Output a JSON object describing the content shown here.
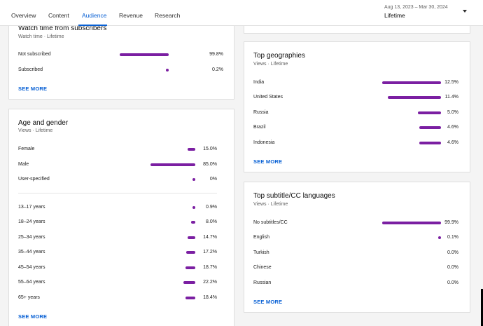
{
  "tabs": [
    "Overview",
    "Content",
    "Audience",
    "Revenue",
    "Research"
  ],
  "date_range": "Aug 13, 2023 – Mar 30, 2024",
  "date_label": "Lifetime",
  "accent_color": "#065fd4",
  "bar_color": "#7b1fa2",
  "watch_time": {
    "title": "Watch time from subscribers",
    "subtitle": "Watch time · Lifetime",
    "rows": [
      {
        "label": "Not subscribed",
        "value": "99.8%",
        "pct": 99.8
      },
      {
        "label": "Subscribed",
        "value": "0.2%",
        "pct": 0.2
      }
    ],
    "see_more": "SEE MORE"
  },
  "age_gender": {
    "title": "Age and gender",
    "subtitle": "Views · Lifetime",
    "gender_rows": [
      {
        "label": "Female",
        "value": "15.0%",
        "pct": 15.0
      },
      {
        "label": "Male",
        "value": "85.0%",
        "pct": 85.0
      },
      {
        "label": "User-specified",
        "value": "0%",
        "pct": 0
      }
    ],
    "age_rows": [
      {
        "label": "13–17 years",
        "value": "0.9%",
        "pct": 0.9
      },
      {
        "label": "18–24 years",
        "value": "8.0%",
        "pct": 8.0
      },
      {
        "label": "25–34 years",
        "value": "14.7%",
        "pct": 14.7
      },
      {
        "label": "35–44 years",
        "value": "17.2%",
        "pct": 17.2
      },
      {
        "label": "45–54 years",
        "value": "18.7%",
        "pct": 18.7
      },
      {
        "label": "55–64 years",
        "value": "22.2%",
        "pct": 22.2
      },
      {
        "label": "65+ years",
        "value": "18.4%",
        "pct": 18.4
      }
    ],
    "see_more": "SEE MORE"
  },
  "geographies": {
    "title": "Top geographies",
    "subtitle": "Views · Lifetime",
    "rows": [
      {
        "label": "India",
        "value": "12.5%",
        "pct": 12.5
      },
      {
        "label": "United States",
        "value": "11.4%",
        "pct": 11.4
      },
      {
        "label": "Russia",
        "value": "5.0%",
        "pct": 5.0
      },
      {
        "label": "Brazil",
        "value": "4.6%",
        "pct": 4.6
      },
      {
        "label": "Indonesia",
        "value": "4.6%",
        "pct": 4.6
      }
    ],
    "see_more": "SEE MORE"
  },
  "subtitles": {
    "title": "Top subtitle/CC languages",
    "subtitle": "Views · Lifetime",
    "rows": [
      {
        "label": "No subtitles/CC",
        "value": "99.9%",
        "pct": 99.9
      },
      {
        "label": "English",
        "value": "0.1%",
        "pct": 0.1
      },
      {
        "label": "Turkish",
        "value": "0.0%",
        "pct": 0
      },
      {
        "label": "Chinese",
        "value": "0.0%",
        "pct": 0
      },
      {
        "label": "Russian",
        "value": "0.0%",
        "pct": 0
      }
    ],
    "see_more": "SEE MORE"
  }
}
